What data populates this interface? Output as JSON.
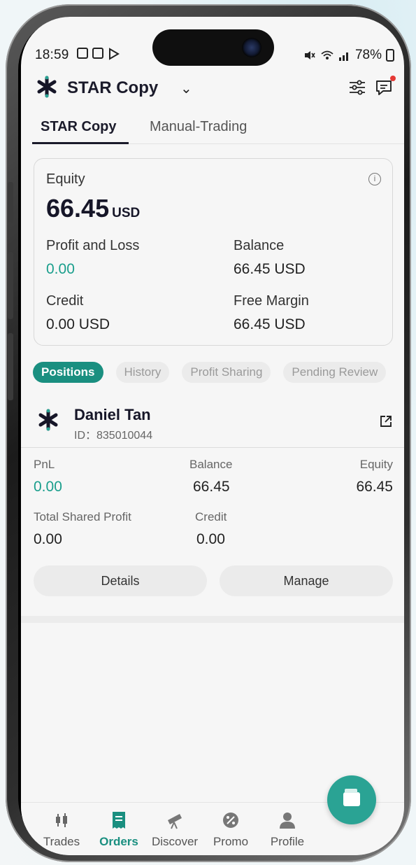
{
  "status_bar": {
    "time": "18:59",
    "battery": "78%"
  },
  "app_bar": {
    "title": "STAR Copy",
    "chevron": "⌄"
  },
  "tabs": [
    {
      "label": "STAR Copy"
    },
    {
      "label": "Manual-Trading"
    }
  ],
  "account_card": {
    "equity_label": "Equity",
    "equity_value": "66.45",
    "equity_unit": "USD",
    "info_glyph": "i",
    "pnl_label": "Profit and Loss",
    "pnl_value": "0.00",
    "balance_label": "Balance",
    "balance_value": "66.45 USD",
    "credit_label": "Credit",
    "credit_value": "0.00 USD",
    "free_margin_label": "Free Margin",
    "free_margin_value": "66.45 USD"
  },
  "chips": [
    {
      "label": "Positions"
    },
    {
      "label": "History"
    },
    {
      "label": "Profit Sharing"
    },
    {
      "label": "Pending Review"
    }
  ],
  "trader": {
    "name": "Daniel Tan",
    "id": "ID：835010044"
  },
  "stats": {
    "pnl_label": "PnL",
    "pnl_value": "0.00",
    "balance_label": "Balance",
    "balance_value": "66.45",
    "equity_label": "Equity",
    "equity_value": "66.45",
    "shared_profit_label": "Total Shared Profit",
    "shared_profit_value": "0.00",
    "credit_label": "Credit",
    "credit_value": "0.00"
  },
  "actions": {
    "details_label": "Details",
    "manage_label": "Manage"
  },
  "bottom_nav": [
    {
      "label": "Trades",
      "icon": "candlestick-icon"
    },
    {
      "label": "Orders",
      "icon": "receipt-icon"
    },
    {
      "label": "Discover",
      "icon": "telescope-icon"
    },
    {
      "label": "Promo",
      "icon": "percent-badge-icon"
    },
    {
      "label": "Profile",
      "icon": "person-icon"
    }
  ],
  "colors": {
    "accent": "#1a8f80",
    "positive": "#1a9e8c",
    "dark_text": "#161628"
  }
}
